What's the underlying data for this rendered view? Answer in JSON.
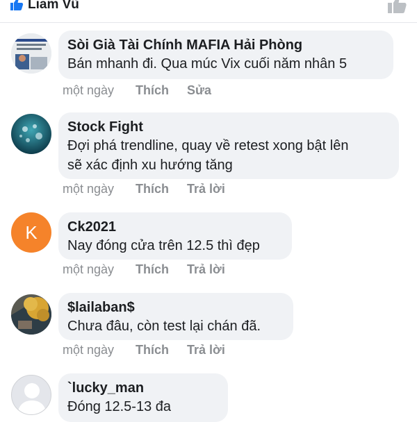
{
  "header": {
    "user_name": "Liam Vũ"
  },
  "comments": [
    {
      "author": "Sòi Già Tài Chính  MAFIA Hải Phòng",
      "text": "Bán mhanh  đi. Qua múc Vix cuối năm nhân 5",
      "time": "một ngày",
      "like_label": "Thích",
      "second_action": "Sửa"
    },
    {
      "author": "Stock Fight",
      "text_lines": [
        "Đợi phá trendline, quay về retest xong bật lên",
        "sẽ xác định xu hướng tăng"
      ],
      "time": "một ngày",
      "like_label": "Thích",
      "second_action": "Trả lời"
    },
    {
      "author": "Ck2021",
      "avatar_letter": "K",
      "text": "Nay đóng cửa trên 12.5 thì đẹp",
      "time": "một ngày",
      "like_label": "Thích",
      "second_action": "Trả lời"
    },
    {
      "author": "$lailaban$",
      "text": "Chưa đâu, còn test lại chán đã.",
      "time": "một ngày",
      "like_label": "Thích",
      "second_action": "Trả lời"
    },
    {
      "author": "`lucky_man",
      "text": "Đóng 12.5-13 đa"
    }
  ],
  "colors": {
    "bubble_bg": "#f0f2f5",
    "accent_blue": "#1877f2",
    "meta_gray": "#8a8d91",
    "avatar_orange": "#f5832a"
  },
  "icons": {
    "header_like": "thumbs-up-icon",
    "header_like_right": "thumbs-up-outline-icon",
    "default_avatar": "person-silhouette-icon"
  }
}
